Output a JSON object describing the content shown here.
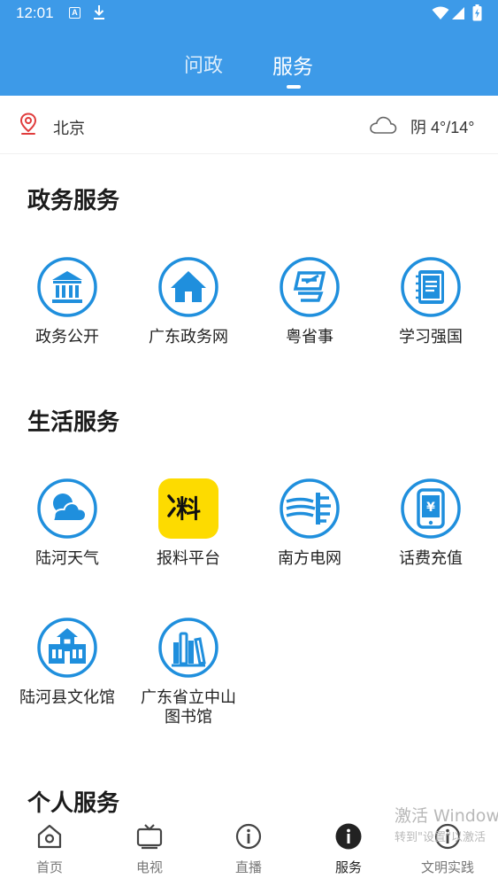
{
  "status_bar": {
    "time": "12:01",
    "icons": [
      "a-icon",
      "download-icon",
      "wifi-icon",
      "signal-icon",
      "battery-icon"
    ]
  },
  "top_tabs": [
    {
      "label": "问政",
      "active": false
    },
    {
      "label": "服务",
      "active": true
    }
  ],
  "location": {
    "city": "北京",
    "weather": "阴 4°/14°"
  },
  "colors": {
    "brand_blue": "#3d9ae8",
    "icon_blue": "#1f8fdd",
    "yellow": "#fddb00"
  },
  "sections": {
    "gov": {
      "title": "政务服务",
      "items": [
        {
          "label": "政务公开",
          "icon": "institution-icon"
        },
        {
          "label": "广东政务网",
          "icon": "home-icon"
        },
        {
          "label": "粤省事",
          "icon": "yue-icon"
        },
        {
          "label": "学习强国",
          "icon": "notebook-icon"
        }
      ]
    },
    "life": {
      "title": "生活服务",
      "items": [
        {
          "label": "陆河天气",
          "icon": "weather-cloud-icon"
        },
        {
          "label": "报料平台",
          "icon": "baoliao-icon",
          "icon_text": "料"
        },
        {
          "label": "南方电网",
          "icon": "power-grid-icon"
        },
        {
          "label": "话费充值",
          "icon": "phone-yuan-icon"
        },
        {
          "label": "陆河县文化馆",
          "icon": "culture-hall-icon"
        },
        {
          "label_line1": "广东省立中山",
          "label_line2": "图书馆",
          "icon": "library-books-icon"
        }
      ]
    },
    "personal": {
      "title": "个人服务"
    }
  },
  "bottom_nav": [
    {
      "label": "首页",
      "icon": "home-outline-icon",
      "active": false
    },
    {
      "label": "电视",
      "icon": "tv-icon",
      "active": false
    },
    {
      "label": "直播",
      "icon": "info-circle-icon",
      "active": false
    },
    {
      "label": "服务",
      "icon": "info-filled-icon",
      "active": true
    },
    {
      "label": "文明实践",
      "icon": "info-circle-icon",
      "active": false
    }
  ],
  "watermark": {
    "line1": "激活 Window",
    "line2": "转到\"设置\"以激活"
  }
}
